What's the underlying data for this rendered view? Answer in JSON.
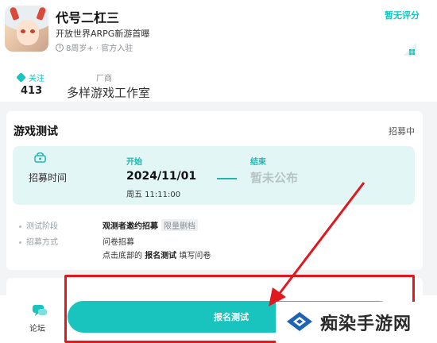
{
  "game": {
    "title": "代号二杠三",
    "subtitle": "开放世界ARPG新游首曝",
    "meta": "8周岁+ · 官方入驻",
    "rating_text": "暂无评分"
  },
  "stats": {
    "follow_label": "关注",
    "follow_count": "413",
    "maker_label": "厂商",
    "maker_name": "多样游戏工作室"
  },
  "test_card": {
    "title": "游戏测试",
    "status": "招募中",
    "recruit_label": "招募时间",
    "start_label": "开始",
    "start_date": "2024/11/01",
    "start_time": "周五 11:11:00",
    "end_label": "结束",
    "end_value": "暂未公布",
    "rows": [
      {
        "label": "测试阶段",
        "value": "观测者邀约招募",
        "tag": "限量删档"
      },
      {
        "label": "招募方式",
        "value": "问卷招募"
      }
    ],
    "instruction": {
      "prefix": "点击底部的",
      "bold": "报名测试",
      "suffix": "填写问卷"
    }
  },
  "bottom": {
    "forum_label": "论坛",
    "signup_label": "报名测试"
  },
  "watermark": {
    "text": "痴染手游网"
  },
  "colors": {
    "accent": "#18c4bd",
    "highlight": "#e0181f",
    "panel": "#e3f6f6"
  }
}
